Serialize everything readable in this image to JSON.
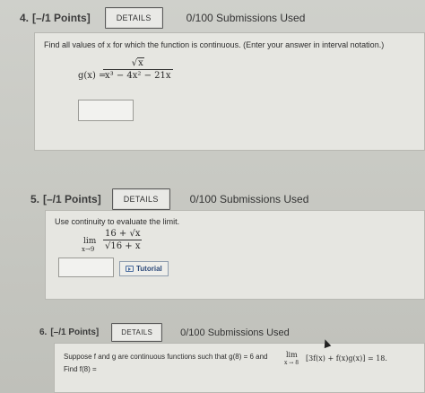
{
  "questions": [
    {
      "number_label": "4.",
      "points_label": "[–/1 Points]",
      "details_label": "DETAILS",
      "submissions": "0/100 Submissions Used",
      "prompt": "Find all values of x for which the function is continuous. (Enter your answer in interval notation.)",
      "fn_lhs": "g(x) =",
      "fn_num_radical": "√",
      "fn_num_radicand": "x",
      "fn_den": "x³ − 4x² − 21x",
      "answer_value": ""
    },
    {
      "number_label": "5.",
      "points_label": "[–/1 Points]",
      "details_label": "DETAILS",
      "submissions": "0/100 Submissions Used",
      "prompt": "Use continuity to evaluate the limit.",
      "lim_word": "lim",
      "lim_sub": "x→9",
      "lim_num": "16 + √x",
      "lim_den": "√16 + x",
      "answer_value": "",
      "tutorial_label": "Tutorial"
    },
    {
      "number_label": "6.",
      "points_label": "[–/1 Points]",
      "details_label": "DETAILS",
      "submissions": "0/100 Submissions Used",
      "prompt": "Suppose f and g are continuous functions such that g(8) = 6 and",
      "lim_word": "lim",
      "lim_sub": "x → 8",
      "lim_expr": "[3f(x) + f(x)g(x)] = 18.",
      "find_label": "Find f(8) ="
    }
  ]
}
